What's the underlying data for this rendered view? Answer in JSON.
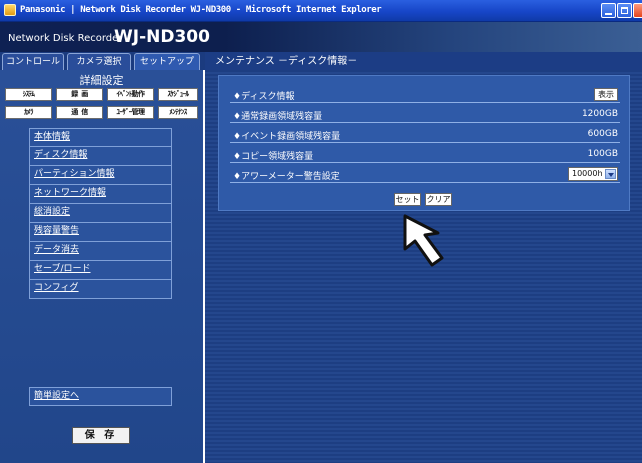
{
  "window": {
    "title": "Panasonic | Network Disk Recorder WJ-ND300 - Microsoft Internet Explorer"
  },
  "header": {
    "small_title": "Network Disk Recorder",
    "model": "WJ-ND300"
  },
  "tabs": [
    {
      "label": "コントロール"
    },
    {
      "label": "カメラ選択"
    },
    {
      "label": "セットアップ"
    }
  ],
  "sidebar": {
    "heading": "詳細設定",
    "menu_buttons": [
      {
        "label": "ｼｽﾃﾑ"
      },
      {
        "label": "録 画"
      },
      {
        "label": "ｲﾍﾞﾝﾄ動作"
      },
      {
        "label": "ｽｹｼﾞｭｰﾙ"
      },
      {
        "label": "ｶﾒﾗ"
      },
      {
        "label": "通 信"
      },
      {
        "label": "ﾕｰｻﾞｰ管理"
      },
      {
        "label": "ﾒﾝﾃﾅﾝｽ"
      }
    ],
    "nav_items": [
      {
        "label": "本体情報"
      },
      {
        "label": "ディスク情報"
      },
      {
        "label": "パーティション情報"
      },
      {
        "label": "ネットワーク情報"
      },
      {
        "label": "総消設定"
      },
      {
        "label": "残容量警告"
      },
      {
        "label": "データ消去"
      },
      {
        "label": "セーブ/ロード"
      },
      {
        "label": "コンフィグ"
      }
    ],
    "easy_setup_link": "簡単設定へ",
    "save_button": "保 存"
  },
  "main": {
    "title": "メンテナンス －ディスク情報－",
    "rows": [
      {
        "label": "♦ディスク情報",
        "button": "表示"
      },
      {
        "label": "♦通常録画領域残容量",
        "value": "1200GB"
      },
      {
        "label": "♦イベント録画領域残容量",
        "value": "600GB"
      },
      {
        "label": "♦コピー領域残容量",
        "value": "100GB"
      },
      {
        "label": "♦アワーメーター警告設定",
        "select": "10000h"
      }
    ],
    "set_button": "セット",
    "clear_button": "クリア"
  },
  "colors": {
    "header_dark": "#0e2153",
    "panel_blue": "#2a5098",
    "infobox_blue": "#2f5aa8",
    "titlebar_blue": "#1746c8"
  }
}
